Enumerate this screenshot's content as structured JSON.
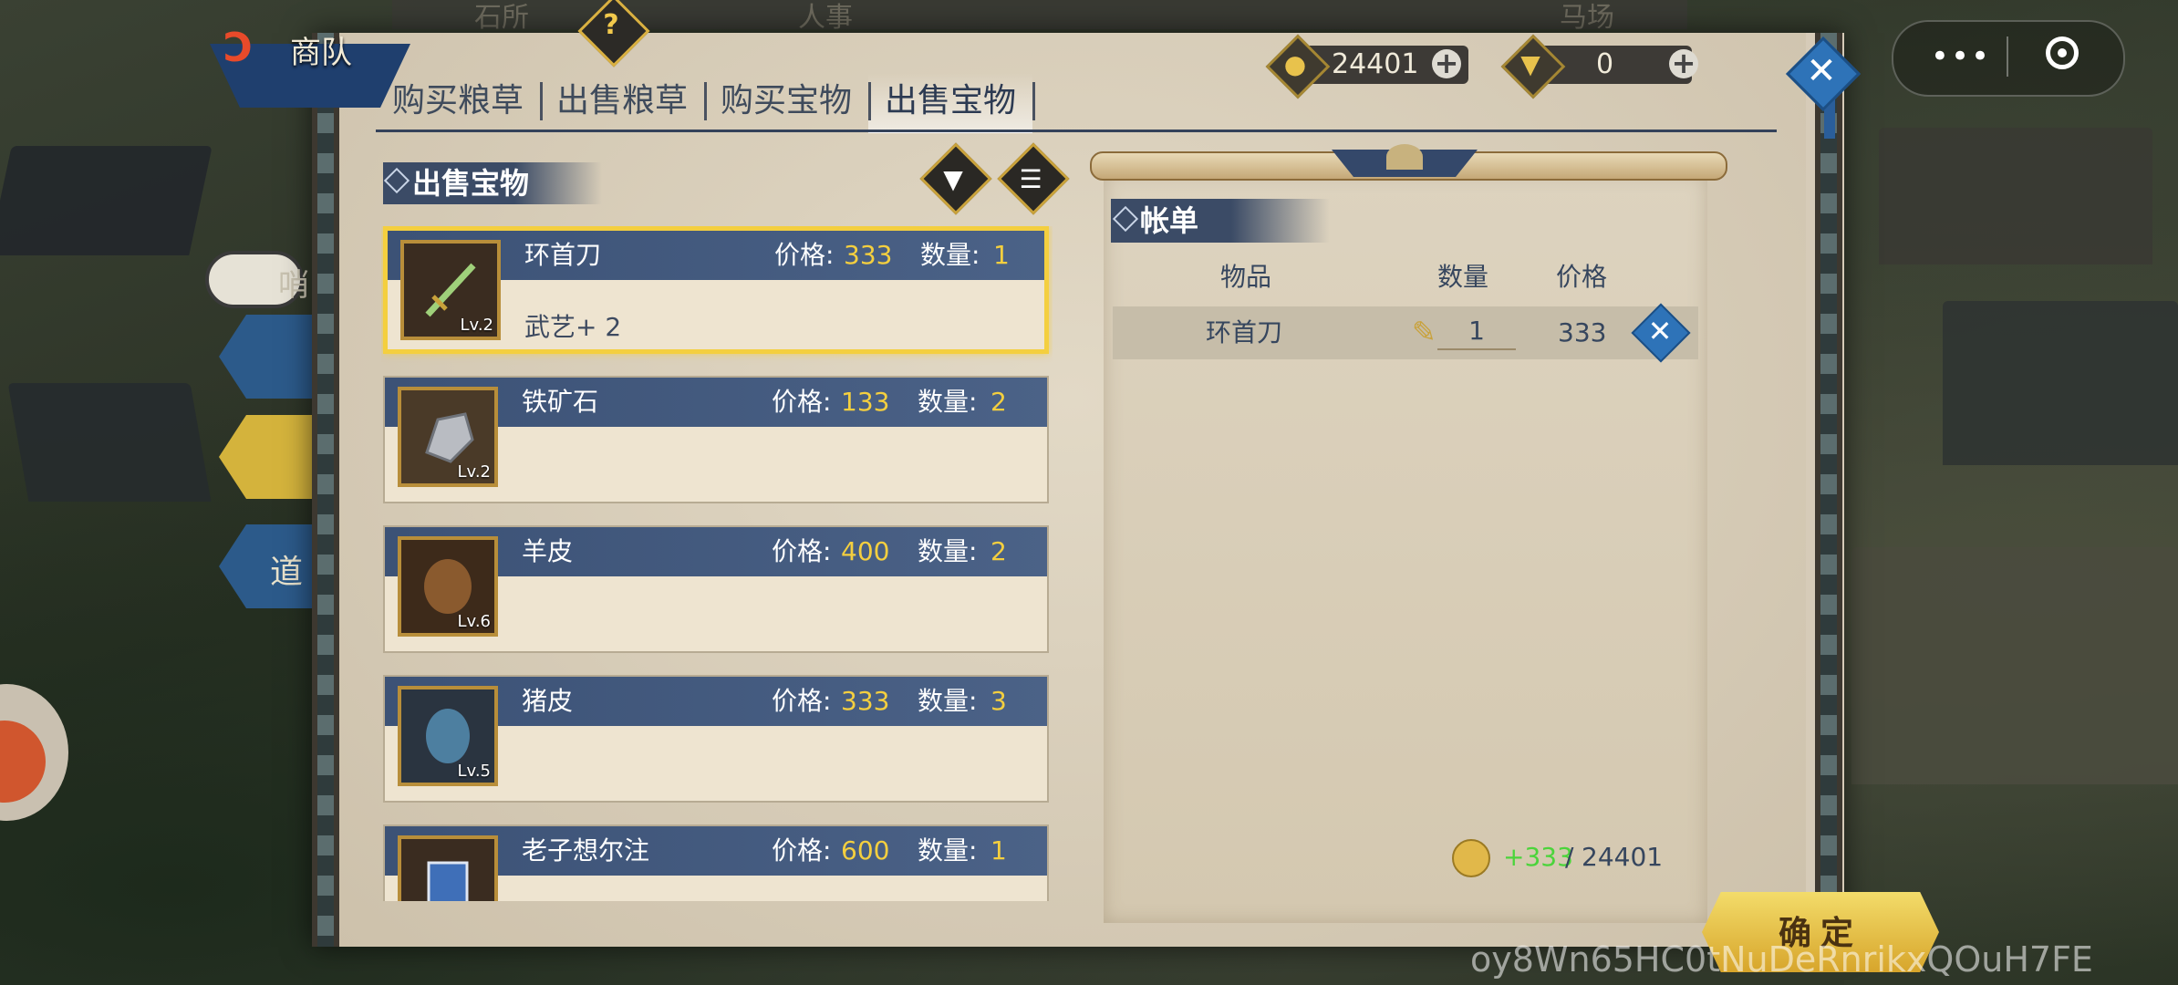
{
  "scene": {
    "top_labels": [
      "石所",
      "人事",
      "马场"
    ],
    "horn_label": "哨",
    "side_label": "道"
  },
  "header": {
    "title": "商队",
    "help_glyph": "?"
  },
  "tabs": [
    {
      "label": "购买粮草",
      "active": false
    },
    {
      "label": "出售粮草",
      "active": false
    },
    {
      "label": "购买宝物",
      "active": false
    },
    {
      "label": "出售宝物",
      "active": true
    }
  ],
  "currency": {
    "coins": "24401",
    "ingots": "0"
  },
  "list": {
    "title": "出售宝物",
    "price_label": "价格:",
    "qty_label": "数量:",
    "items": [
      {
        "name": "环首刀",
        "price": "333",
        "qty": "1",
        "level": "Lv.2",
        "attr": "武艺+ 2",
        "selected": true
      },
      {
        "name": "铁矿石",
        "price": "133",
        "qty": "2",
        "level": "Lv.2",
        "attr": "",
        "selected": false
      },
      {
        "name": "羊皮",
        "price": "400",
        "qty": "2",
        "level": "Lv.6",
        "attr": "",
        "selected": false
      },
      {
        "name": "猪皮",
        "price": "333",
        "qty": "3",
        "level": "Lv.5",
        "attr": "",
        "selected": false
      },
      {
        "name": "老子想尔注",
        "price": "600",
        "qty": "1",
        "level": "",
        "attr": "",
        "selected": false
      }
    ]
  },
  "bill": {
    "title": "帐单",
    "col_item": "物品",
    "col_qty": "数量",
    "col_price": "价格",
    "row": {
      "name": "环首刀",
      "qty": "1",
      "price": "333"
    },
    "gain": "+333",
    "separator": "/",
    "max": "24401"
  },
  "confirm_label": "确定",
  "watermark": "oy8Wn65HC0tNuDeRnrikxQOuH7FE",
  "colors": {
    "accent_gold": "#f4cf3f",
    "item_bar": "#3c5276",
    "gain_green": "#4bd43b",
    "close_blue": "#2e73b8"
  }
}
